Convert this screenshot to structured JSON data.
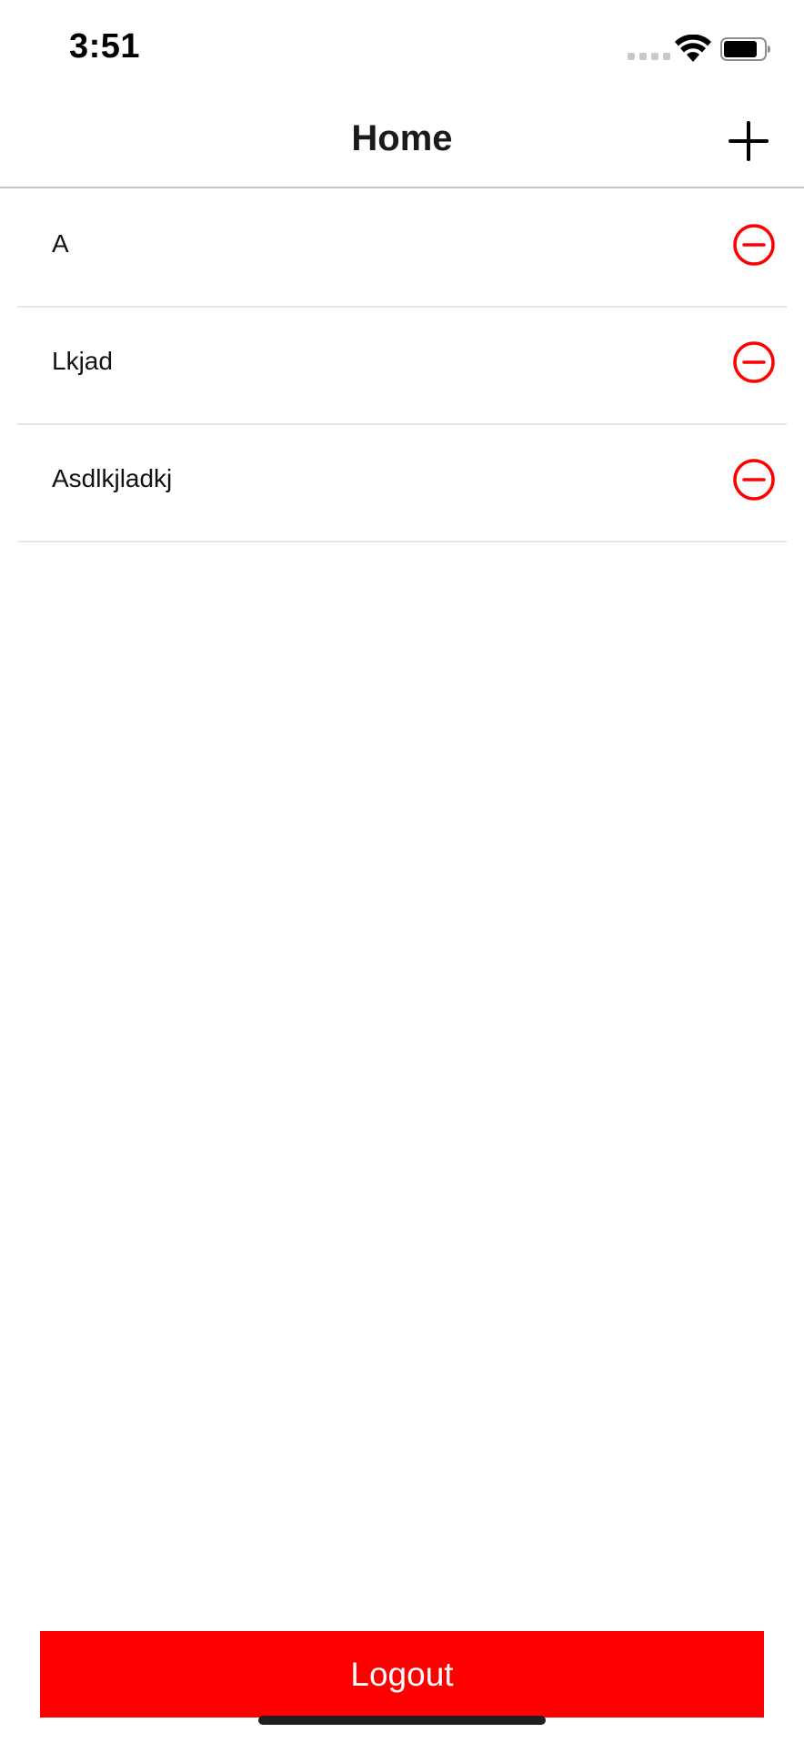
{
  "status_bar": {
    "time": "3:51",
    "icons": [
      "cellular-signal-icon",
      "wifi-icon",
      "battery-icon"
    ]
  },
  "nav": {
    "title": "Home",
    "add_icon": "plus-icon"
  },
  "list": {
    "items": [
      {
        "label": "A",
        "action_icon": "remove-circle-icon"
      },
      {
        "label": "Lkjad",
        "action_icon": "remove-circle-icon"
      },
      {
        "label": "Asdlkjladkj",
        "action_icon": "remove-circle-icon"
      }
    ]
  },
  "footer": {
    "logout_label": "Logout"
  },
  "colors": {
    "accent": "#ff0000",
    "separator": "#e6e6e6",
    "background": "#ffffff"
  }
}
